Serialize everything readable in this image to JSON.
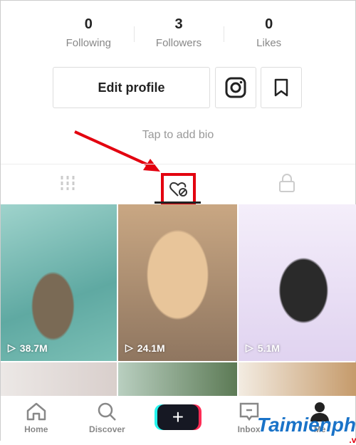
{
  "stats": [
    {
      "value": "0",
      "label": "Following"
    },
    {
      "value": "3",
      "label": "Followers"
    },
    {
      "value": "0",
      "label": "Likes"
    }
  ],
  "profile": {
    "edit_label": "Edit profile",
    "bio_placeholder": "Tap to add bio"
  },
  "tabs": {
    "active": "liked",
    "items": [
      "videos",
      "liked",
      "private"
    ]
  },
  "videos": [
    {
      "views": "38.7M"
    },
    {
      "views": "24.1M"
    },
    {
      "views": "5.1M"
    }
  ],
  "nav": {
    "home": "Home",
    "discover": "Discover",
    "inbox": "Inbox",
    "me": "Me"
  },
  "watermark": {
    "brand": "Taimienphi",
    "tld": ".vn"
  },
  "colors": {
    "highlight": "#e3000f",
    "accent_cyan": "#25f4ee",
    "accent_pink": "#fe2c55"
  }
}
